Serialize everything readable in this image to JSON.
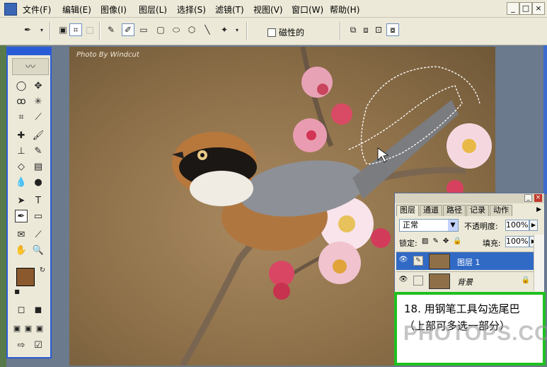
{
  "menubar": {
    "items": [
      "文件(F)",
      "编辑(E)",
      "图像(I)",
      "图层(L)",
      "选择(S)",
      "滤镜(T)",
      "视图(V)",
      "窗口(W)",
      "帮助(H)"
    ],
    "window_controls": [
      "_",
      "□",
      "×"
    ]
  },
  "options_bar": {
    "magnetic_label": "磁性的",
    "icons": [
      "pen-tool-icon",
      "path-mode-icon",
      "shape-layer-icon",
      "rectangle-shape-icon",
      "rounded-rect-icon",
      "ellipse-icon",
      "polygon-icon",
      "line-icon",
      "custom-shape-icon"
    ]
  },
  "canvas": {
    "credit": "Photo By Windcut"
  },
  "layers_panel": {
    "tabs": [
      "图层",
      "通道",
      "路径",
      "记录",
      "动作"
    ],
    "blend_mode": "正常",
    "opacity_label": "不透明度:",
    "opacity_value": "100%",
    "lock_label": "锁定:",
    "fill_label": "填充:",
    "fill_value": "100%",
    "layers": [
      {
        "name": "图层 1",
        "selected": true
      },
      {
        "name": "背景",
        "selected": false
      }
    ]
  },
  "caption": {
    "text": "18. 用钢笔工具勾选尾巴（上部可多选一部分）",
    "watermark": "PHOTOPS.COM"
  },
  "colors": {
    "foreground": "#8a5a2e",
    "background": "#000000",
    "accent": "#2a5bd7",
    "caption_border": "#20c020"
  }
}
